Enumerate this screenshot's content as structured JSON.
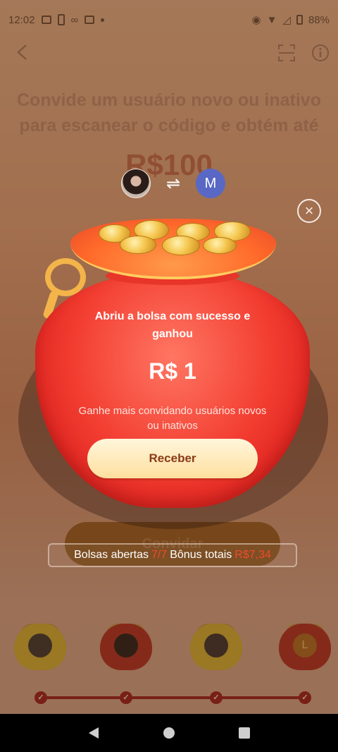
{
  "status_bar": {
    "time": "12:02",
    "battery": "88%"
  },
  "background": {
    "headline_line1": "Convide um usuário novo ou inativo",
    "headline_line2": "para escanear o código e obtém até",
    "amount": "R$100",
    "swap_symbol": "⇌",
    "avatar_letter": "M",
    "invite_label": "Convidar"
  },
  "modal": {
    "close_symbol": "×",
    "title": "Abriu a bolsa com sucesso e ganhou",
    "amount": "R$ 1",
    "hint": "Ganhe mais convidando usuários novos ou inativos",
    "receive_label": "Receber"
  },
  "stats": {
    "opened_label": "Bolsas abertas",
    "opened_value": "7/7",
    "bonus_label": "Bônus totais",
    "bonus_value": "R$7,34"
  },
  "bags_row": {
    "last_bag_letter": "L",
    "check_symbol": "✓"
  },
  "icons": [
    "back-arrow-icon",
    "scan-icon",
    "info-icon",
    "swap-icon",
    "close-icon",
    "check-icon"
  ]
}
